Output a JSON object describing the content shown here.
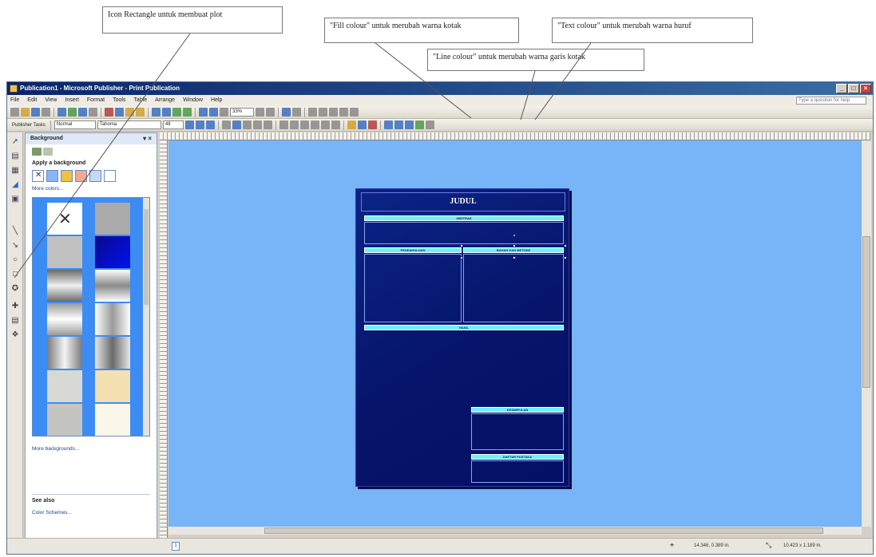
{
  "annotations": {
    "rectangle_icon": "Icon Rectangle untuk membuat plot",
    "fill_colour": "\"Fill colour\" untuk merubah warna kotak",
    "text_colour": "\"Text colour\" untuk merubah warna huruf",
    "line_colour": "\"Line colour\" untuk merubah warna garis kotak"
  },
  "window": {
    "title": "Publication1 - Microsoft Publisher - Print Publication",
    "buttons": {
      "minimize": "_",
      "maximize": "□",
      "close": "×"
    }
  },
  "menubar": {
    "items": [
      "File",
      "Edit",
      "View",
      "Insert",
      "Format",
      "Tools",
      "Table",
      "Arrange",
      "Window",
      "Help"
    ],
    "help_placeholder": "Type a question for help"
  },
  "toolbar2": {
    "publisher_tasks": "Publisher Tasks",
    "style": "Normal",
    "font": "Tahoma",
    "size": "48"
  },
  "toolbar1": {
    "zoom": "33%"
  },
  "task_pane": {
    "title": "Background",
    "apply_label": "Apply a background",
    "more_colors": "More colors...",
    "more_backgrounds": "More backgrounds...",
    "see_also": "See also",
    "color_schemes": "Color Schemes...",
    "swatch_colors": [
      "#ffffff",
      "#8cb4f8",
      "#f0c040",
      "#f4a890",
      "#c8d8f0",
      "#ffffff"
    ]
  },
  "poster": {
    "title": "JUDUL",
    "sections": {
      "top": "ABSTRAK",
      "left": "PENDAHULUAN",
      "right": "BAHAN DAN METODE",
      "middle": "HASIL",
      "bottom_right": "KESIMPULAN",
      "bottom_right_2": "DAFTAR PUSTAKA"
    }
  },
  "statusbar": {
    "page": "1",
    "position": "14.346, 0.389 in.",
    "size": "10.423 x 1.189 in."
  },
  "colors": {
    "workspace": "#78b4f8",
    "poster_bg": "#0b2486",
    "bar_fill": "#6ef0f8",
    "titlebar": "#0a246a"
  }
}
